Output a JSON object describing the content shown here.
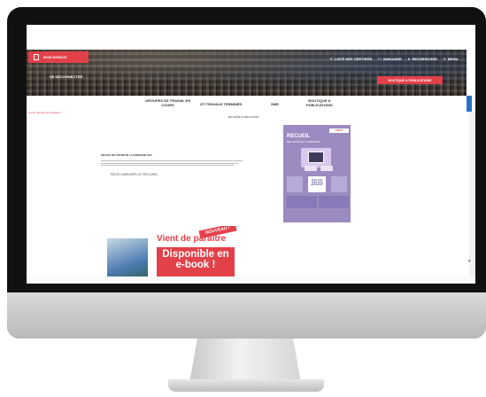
{
  "header": {
    "account_label": "MON ESPACE",
    "logout_label": "SE DÉCONNECTER",
    "nav": [
      {
        "label": "LISTE DES CERTIFIÉS",
        "icon": "list-icon"
      },
      {
        "label": "ANNUAIRE",
        "icon": "book-icon"
      },
      {
        "label": "RECHERCHER",
        "icon": "search-icon"
      },
      {
        "label": "MENU",
        "icon": "menu-icon"
      }
    ],
    "shop_button": "BOUTIQUE & PUBLICATIONS"
  },
  "menu": [
    {
      "line1": "GROUPES DE TRAVAIL EN",
      "line2": "COURS"
    },
    {
      "line1": "GT TRAVAUX TERMINÉS",
      "line2": ""
    },
    {
      "line1": "SMR",
      "line2": ""
    },
    {
      "line1": "BOUTIQUE &",
      "line2": "PUBLICATIONS"
    }
  ],
  "breadcrumb": "Accueil / Boutique & Publications",
  "section_title": "BOUTIQUE & PUBLICATIONS",
  "article": {
    "title": "RECUEIL DES TEXTES DE LA COMPAGNIE 2020",
    "download_link": "TÉLÉCHARGER LE RECUEIL"
  },
  "book": {
    "brand": "CNCC",
    "title": "RECUEIL",
    "subtitle": "DES TEXTES DE LA COMPAGNIE",
    "edition_label": "ÉDITION",
    "edition_year": "2020"
  },
  "ad": {
    "badge": "NOUVEAU !",
    "headline": "Vient de paraître",
    "cta": "Disponible en e-book !"
  }
}
